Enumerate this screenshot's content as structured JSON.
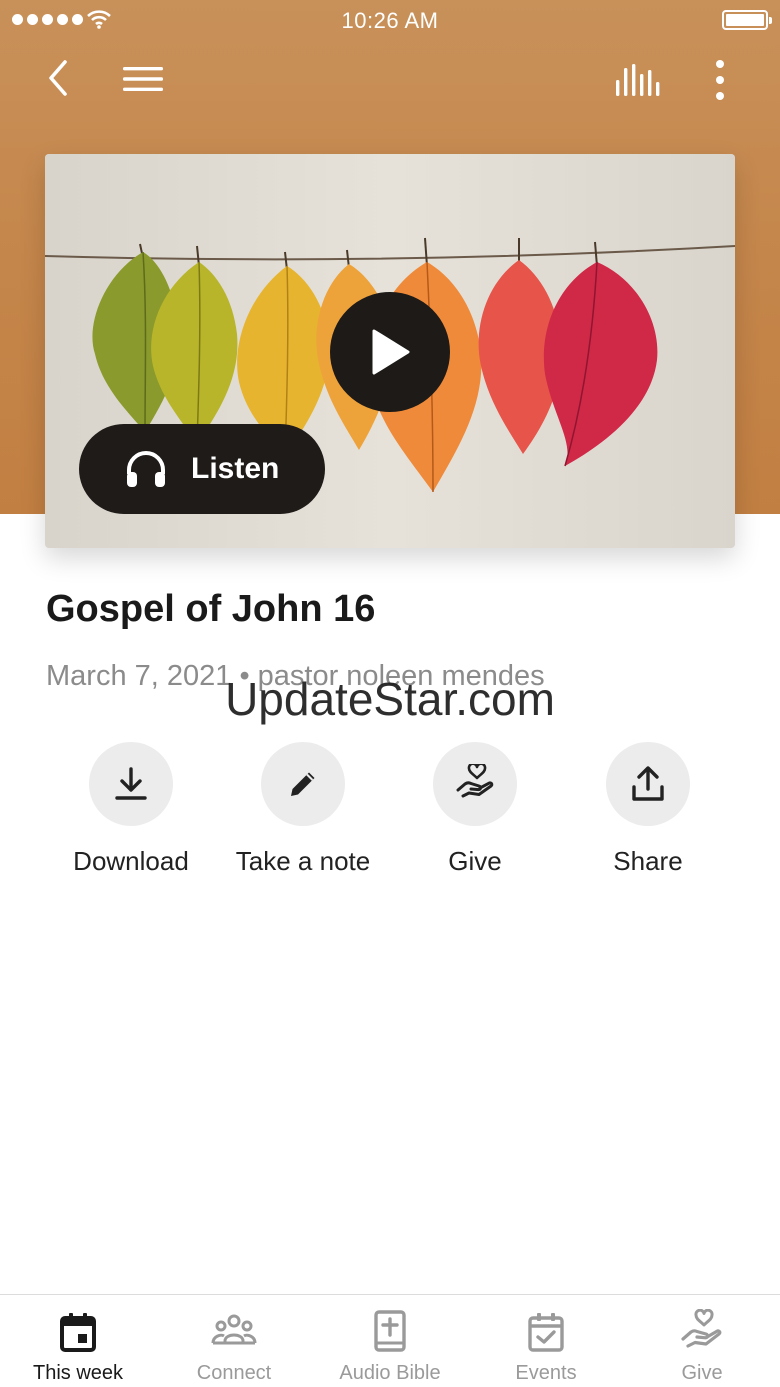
{
  "status_bar": {
    "time": "10:26 AM"
  },
  "nav": {
    "back_icon": "chevron-left-icon",
    "menu_icon": "hamburger-menu-icon",
    "stats_icon": "audio-bars-icon",
    "more_icon": "vertical-dots-icon"
  },
  "media": {
    "artwork": "autumn leaves hanging on a string",
    "play_icon": "play-icon",
    "listen_label": "Listen",
    "listen_icon": "headphones-icon"
  },
  "sermon": {
    "title": "Gospel of John 16",
    "meta": "March 7, 2021 • pastor noleen mendes"
  },
  "watermark": "UpdateStar.com",
  "actions": [
    {
      "label": "Download",
      "icon": "download-icon"
    },
    {
      "label": "Take a note",
      "icon": "pencil-icon"
    },
    {
      "label": "Give",
      "icon": "heart-hand-icon"
    },
    {
      "label": "Share",
      "icon": "share-icon"
    }
  ],
  "tabs": [
    {
      "label": "This week",
      "icon": "calendar-icon",
      "active": true
    },
    {
      "label": "Connect",
      "icon": "group-icon",
      "active": false
    },
    {
      "label": "Audio Bible",
      "icon": "bible-icon",
      "active": false
    },
    {
      "label": "Events",
      "icon": "calendar-check-icon",
      "active": false
    },
    {
      "label": "Give",
      "icon": "heart-hand-icon",
      "active": false
    }
  ],
  "colors": {
    "header_brown": "#c5874c",
    "dark_button": "#1f1b18",
    "active_tab": "#1a1a1a",
    "inactive_tab": "#9a9a9a"
  }
}
